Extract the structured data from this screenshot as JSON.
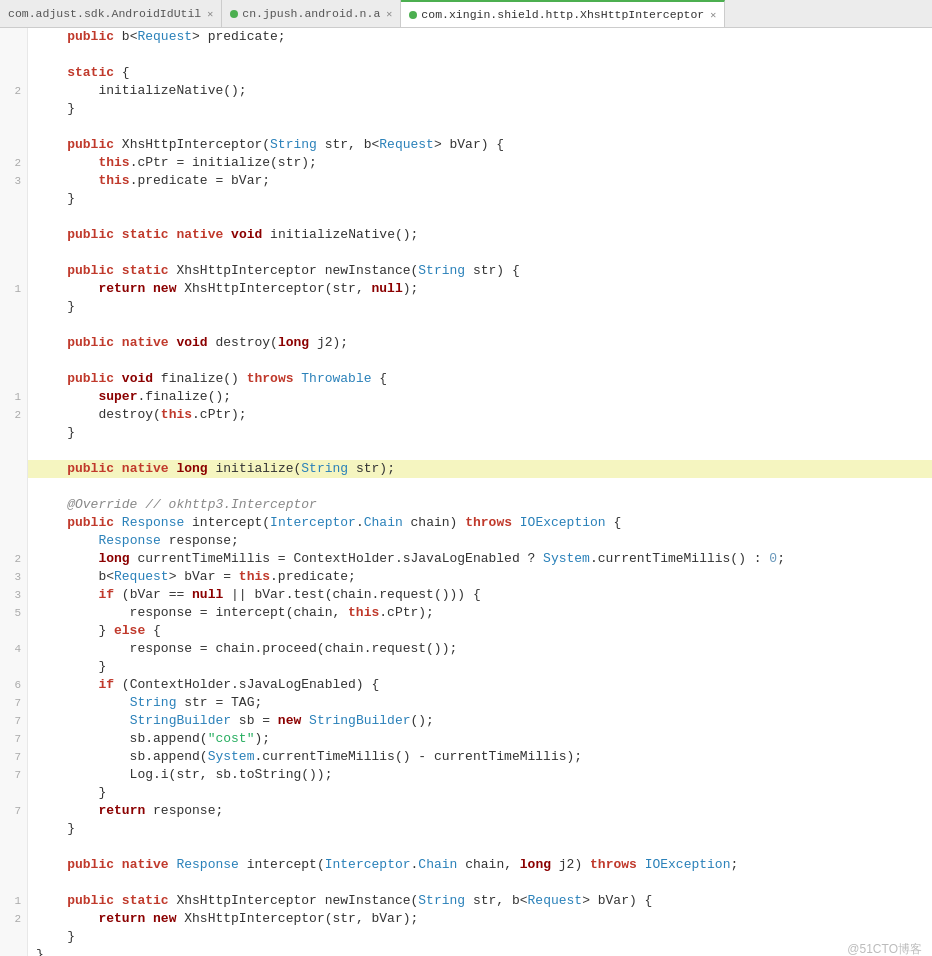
{
  "tabs": [
    {
      "id": "tab1",
      "label": "com.adjust.sdk.AndroidIdUtil",
      "active": false,
      "dot_color": null
    },
    {
      "id": "tab2",
      "label": "cn.jpush.android.n.a",
      "active": false,
      "dot_color": null
    },
    {
      "id": "tab3",
      "label": "com.xingin.shield.http.XhsHttpInterceptor",
      "active": true,
      "dot_color": "#4caf50"
    }
  ],
  "watermark": "@51CTO博客"
}
